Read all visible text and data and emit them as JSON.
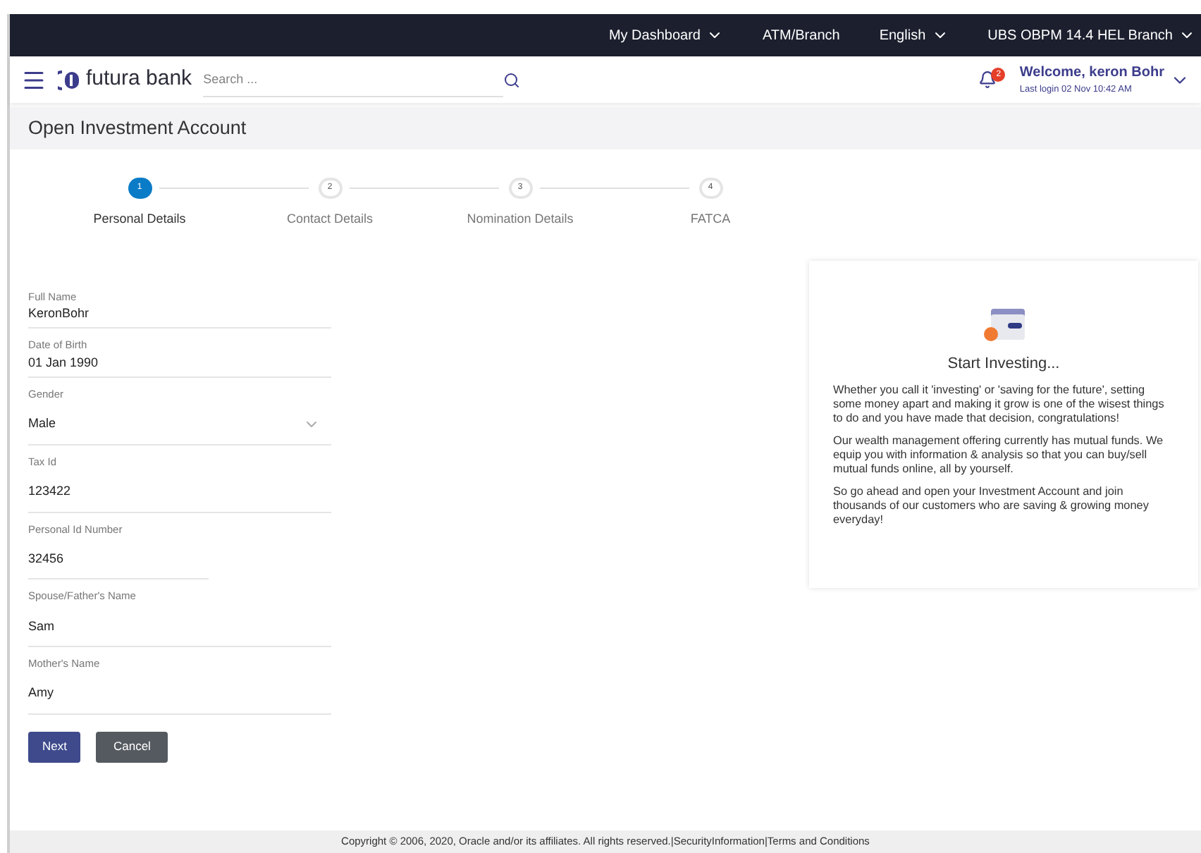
{
  "top_bar": {
    "items": [
      {
        "label": "My Dashboard",
        "dropdown": true
      },
      {
        "label": "ATM/Branch",
        "dropdown": false
      },
      {
        "label": "English",
        "dropdown": true
      },
      {
        "label": "UBS OBPM 14.4 HEL Branch",
        "dropdown": true
      }
    ]
  },
  "header": {
    "brand": "futura bank",
    "search": {
      "placeholder": "Search ..."
    },
    "notification_count": "2",
    "welcome": "Welcome, keron Bohr",
    "last_login": "Last login 02 Nov 10:42 AM"
  },
  "page_title": "Open Investment Account",
  "steps": [
    {
      "number": "1",
      "label": "Personal Details",
      "selected": true
    },
    {
      "number": "2",
      "label": "Contact Details",
      "selected": false
    },
    {
      "number": "3",
      "label": "Nomination Details",
      "selected": false
    },
    {
      "number": "4",
      "label": "FATCA",
      "selected": false
    }
  ],
  "fields": [
    {
      "kind": "text",
      "label": "Full Name",
      "value": "KeronBohr"
    },
    {
      "kind": "text",
      "label": "Date of Birth",
      "value": "01 Jan 1990"
    },
    {
      "kind": "select",
      "label": "Gender",
      "value": "Male"
    },
    {
      "kind": "text",
      "label": "Tax Id",
      "value": "123422"
    },
    {
      "kind": "text",
      "label": "Personal Id Number",
      "value": "32456"
    },
    {
      "kind": "text",
      "label": "Spouse/Father's Name",
      "value": "Sam"
    },
    {
      "kind": "text",
      "label": "Mother's Name",
      "value": "Amy"
    }
  ],
  "buttons": [
    {
      "kind": "primary",
      "label": "Next"
    },
    {
      "kind": "secondary",
      "label": "Cancel"
    }
  ],
  "info_card": {
    "title": "Start Investing...",
    "paragraphs": [
      "Whether you call it 'investing' or 'saving for the future', setting some money apart and making it grow is one of the wisest things to do and you have made that decision, congratulations!",
      "Our wealth management offering currently has mutual funds. We equip you with information & analysis so that you can buy/sell mutual funds online, all by yourself.",
      "So go ahead and open your Investment Account and join thousands of our customers who are saving & growing money everyday!"
    ]
  },
  "footer": "Copyright © 2006, 2020, Oracle and/or its affiliates. All rights reserved.|SecurityInformation|Terms and Conditions"
}
